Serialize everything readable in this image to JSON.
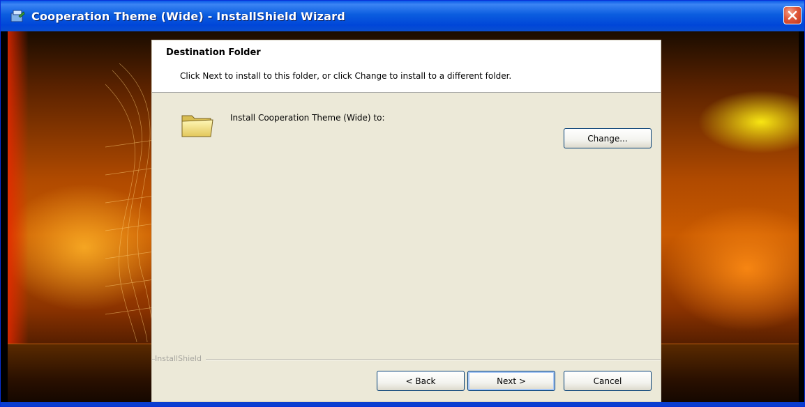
{
  "window": {
    "title": "Cooperation Theme (Wide) - InstallShield Wizard"
  },
  "header": {
    "title": "Destination Folder",
    "subtitle": "Click Next to install to this folder, or click Change to install to a different folder."
  },
  "main": {
    "install_label": "Install Cooperation Theme (Wide) to:",
    "change_label": "Change..."
  },
  "footer": {
    "brand": "InstallShield",
    "back_label": "< Back",
    "next_label": "Next >",
    "cancel_label": "Cancel"
  },
  "colors": {
    "titlebar": "#0b5ddf",
    "dialog_bg": "#ece9d8",
    "close_button": "#e0583a"
  }
}
